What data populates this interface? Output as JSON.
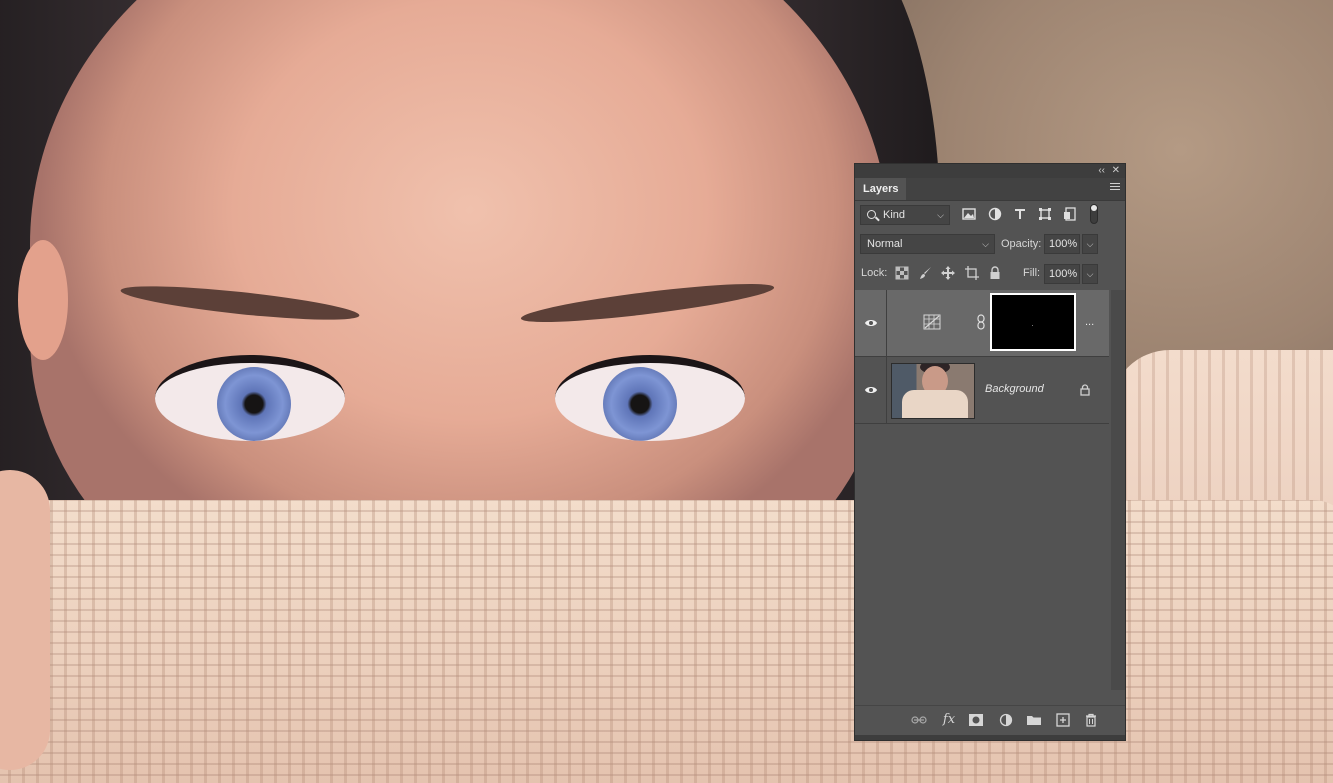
{
  "canvas": {
    "description_icon": "photo-canvas"
  },
  "panel": {
    "tab_label": "Layers",
    "filter": {
      "kind_label": "Kind"
    },
    "blend": {
      "mode": "Normal",
      "opacity_label": "Opacity:",
      "opacity_value": "100%"
    },
    "lock": {
      "label": "Lock:",
      "fill_label": "Fill:",
      "fill_value": "100%"
    },
    "layers": [
      {
        "name": "",
        "type": "adjustment",
        "icon": "levels-adjustment-icon",
        "visible": true,
        "selected": true,
        "more_label": "..."
      },
      {
        "name": "Background",
        "type": "image",
        "visible": true,
        "selected": false,
        "locked": true
      }
    ],
    "colors": {
      "panel_bg": "#535353",
      "selected_layer": "#696969",
      "mask_border": "#ffffff"
    }
  }
}
